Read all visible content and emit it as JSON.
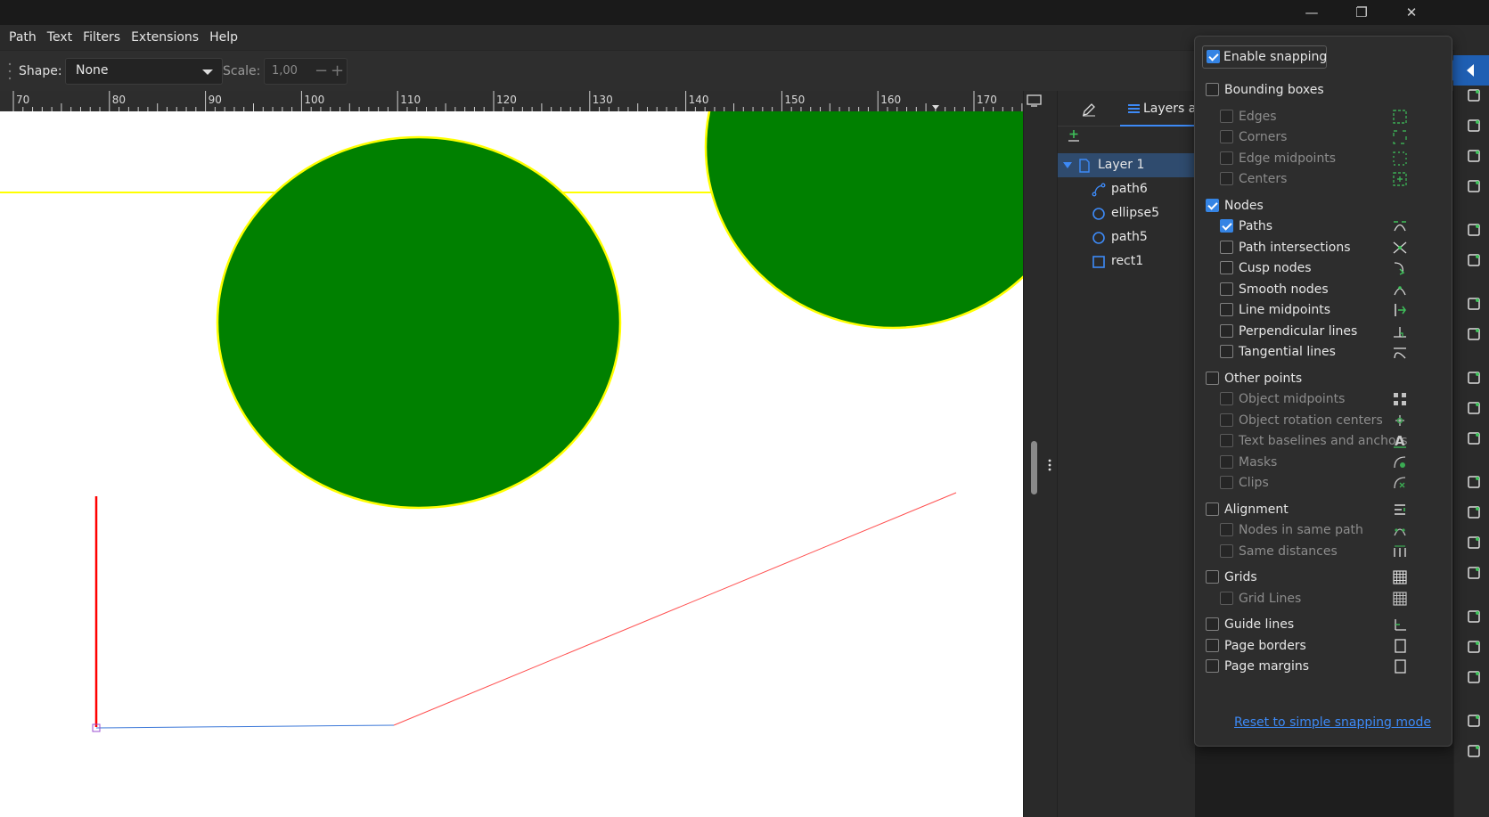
{
  "window": {
    "minimize_glyph": "—",
    "restore_glyph": "❐",
    "close_glyph": "✕"
  },
  "menu": [
    "Path",
    "Text",
    "Filters",
    "Extensions",
    "Help"
  ],
  "toolbar": {
    "shape_label": "Shape:",
    "shape_value": "None",
    "scale_label": "Scale:",
    "scale_value": "1,00",
    "minus": "−",
    "plus": "+"
  },
  "ruler": {
    "labels": [
      "70",
      "80",
      "90",
      "100",
      "110",
      "120",
      "130",
      "140",
      "150",
      "160",
      "170"
    ]
  },
  "layers": {
    "tab_label": "Layers a",
    "rows": [
      {
        "label": "Layer 1",
        "icon": "layer-icon"
      },
      {
        "label": "path6",
        "icon": "path-icon"
      },
      {
        "label": "ellipse5",
        "icon": "ellipse-icon"
      },
      {
        "label": "path5",
        "icon": "ellipse-icon"
      },
      {
        "label": "rect1",
        "icon": "rect-icon"
      }
    ]
  },
  "snapping": {
    "enable": {
      "label": "Enable snapping",
      "checked": true
    },
    "items": [
      {
        "label": "Bounding boxes",
        "checked": false,
        "level": 0
      },
      {
        "label": "Edges",
        "checked": false,
        "level": 1,
        "dim": true,
        "icon": "bbox-edges-icon"
      },
      {
        "label": "Corners",
        "checked": false,
        "level": 1,
        "dim": true,
        "icon": "bbox-corners-icon"
      },
      {
        "label": "Edge midpoints",
        "checked": false,
        "level": 1,
        "dim": true,
        "icon": "bbox-midpoints-icon"
      },
      {
        "label": "Centers",
        "checked": false,
        "level": 1,
        "dim": true,
        "icon": "bbox-centers-icon"
      },
      {
        "label": "Nodes",
        "checked": true,
        "level": 0
      },
      {
        "label": "Paths",
        "checked": true,
        "level": 1,
        "icon": "snap-paths-icon"
      },
      {
        "label": "Path intersections",
        "checked": false,
        "level": 1,
        "icon": "path-intersections-icon"
      },
      {
        "label": "Cusp nodes",
        "checked": false,
        "level": 1,
        "icon": "cusp-nodes-icon"
      },
      {
        "label": "Smooth nodes",
        "checked": false,
        "level": 1,
        "icon": "smooth-nodes-icon"
      },
      {
        "label": "Line midpoints",
        "checked": false,
        "level": 1,
        "icon": "line-midpoints-icon"
      },
      {
        "label": "Perpendicular lines",
        "checked": false,
        "level": 1,
        "icon": "perpendicular-icon"
      },
      {
        "label": "Tangential lines",
        "checked": false,
        "level": 1,
        "icon": "tangential-icon"
      },
      {
        "label": "Other points",
        "checked": false,
        "level": 0
      },
      {
        "label": "Object midpoints",
        "checked": false,
        "level": 1,
        "dim": true,
        "icon": "object-midpoints-icon"
      },
      {
        "label": "Object rotation centers",
        "checked": false,
        "level": 1,
        "dim": true,
        "icon": "rotation-center-icon"
      },
      {
        "label": "Text baselines and anchors",
        "checked": false,
        "level": 1,
        "dim": true,
        "icon": "text-baseline-icon"
      },
      {
        "label": "Masks",
        "checked": false,
        "level": 1,
        "dim": true,
        "icon": "mask-icon"
      },
      {
        "label": "Clips",
        "checked": false,
        "level": 1,
        "dim": true,
        "icon": "clip-icon"
      },
      {
        "label": "Alignment",
        "checked": false,
        "level": 0,
        "icon": "alignment-icon"
      },
      {
        "label": "Nodes in same path",
        "checked": false,
        "level": 1,
        "dim": true,
        "icon": "same-path-icon"
      },
      {
        "label": "Same distances",
        "checked": false,
        "level": 1,
        "dim": true,
        "icon": "same-distances-icon"
      },
      {
        "label": "Grids",
        "checked": false,
        "level": 0,
        "icon": "grid-icon"
      },
      {
        "label": "Grid Lines",
        "checked": false,
        "level": 1,
        "dim": true,
        "icon": "grid-lines-icon"
      },
      {
        "label": "Guide lines",
        "checked": false,
        "level": 0,
        "icon": "guide-lines-icon"
      },
      {
        "label": "Page borders",
        "checked": false,
        "level": 0,
        "icon": "page-borders-icon"
      },
      {
        "label": "Page margins",
        "checked": false,
        "level": 0,
        "icon": "page-margins-icon"
      }
    ],
    "reset_link": "Reset to simple snapping mode"
  },
  "colors": {
    "accent": "#3584e4",
    "shape_fill": "#008000",
    "shape_stroke": "#ffff00",
    "line_red": "#ff0000",
    "line_blue": "#3c78d8"
  }
}
